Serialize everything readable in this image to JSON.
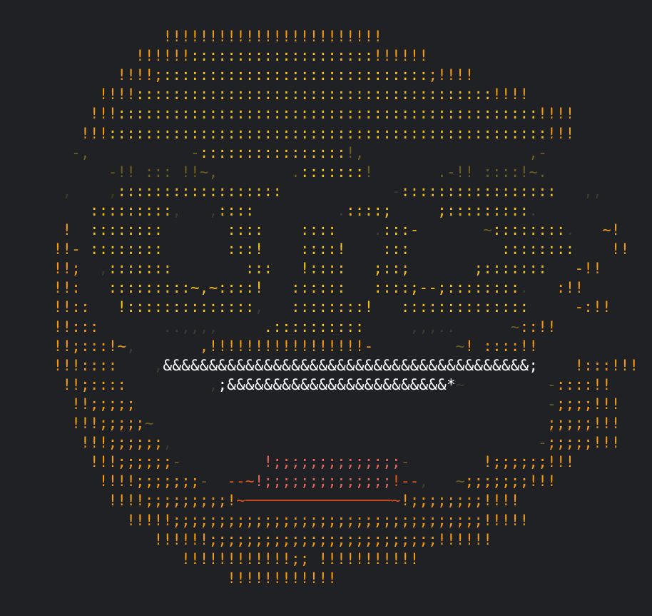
{
  "colors": {
    "background": "#1f2124",
    "rim": "#f29a16",
    "face": "#f3c01d",
    "shadow": "#6b6022",
    "faint": "#3a3b30",
    "teeth": "#ffffff",
    "lips": "#e0655c",
    "mouth_line": "#e0551f",
    "cheek": "#d8892a"
  },
  "rows": [
    [
      [
        "rim",
        "              !!!!!!!!!!!!!!!!!!!!!!!!"
      ]
    ],
    [
      [
        "rim",
        "           !!!!!!"
      ],
      [
        "face",
        "::::::::::::::::::::"
      ],
      [
        "rim",
        "!!!!!!"
      ]
    ],
    [
      [
        "rim",
        "         !!!!;"
      ],
      [
        "face",
        ":::::::::::::::::::::::::::::"
      ],
      [
        "rim",
        ";!!!!"
      ]
    ],
    [
      [
        "rim",
        "       !!!!"
      ],
      [
        "face",
        ":::::::::::::::::::::::::::::::::::::::"
      ],
      [
        "rim",
        "!!!!"
      ]
    ],
    [
      [
        "rim",
        "      !!!"
      ],
      [
        "face",
        "::::::::::::::::::::::::::::::::::::::::::::::"
      ],
      [
        "rim",
        "!!!!"
      ]
    ],
    [
      [
        "rim",
        "     !!!"
      ],
      [
        "face",
        "::::::::::::::::::::::::::::::::::::::::::::::::"
      ],
      [
        "rim",
        "!!!"
      ]
    ],
    [
      [
        "shadow",
        "    -,           -"
      ],
      [
        "face",
        "::::::::::::::::"
      ],
      [
        "shadow",
        "!,                  ,-"
      ]
    ],
    [
      [
        "shadow",
        "        -!! ::: !!~,        ."
      ],
      [
        "face",
        ":::::::"
      ],
      [
        "shadow",
        "!       .-!! ::::!~."
      ]
    ],
    [
      [
        "faint",
        "   ,    ,"
      ],
      [
        "face",
        "::::::::::::::::::"
      ],
      [
        "faint",
        "            -"
      ],
      [
        "face",
        ":::::::::::::::::"
      ],
      [
        "faint",
        "   ,,"
      ]
    ],
    [
      [
        "face",
        "      :::::::::"
      ],
      [
        "faint",
        ",   ,"
      ],
      [
        "face",
        "::::"
      ],
      [
        "faint",
        "         ."
      ],
      [
        "face",
        "::::;"
      ],
      [
        "faint",
        "     "
      ],
      [
        "face",
        ";:::::::::"
      ],
      [
        "faint",
        "."
      ]
    ],
    [
      [
        "rim",
        "   !"
      ],
      [
        "face",
        "  ::::::::"
      ],
      [
        "faint",
        "       "
      ],
      [
        "face",
        "::::    ::::    "
      ],
      [
        "faint",
        "."
      ],
      [
        "face",
        ":::-"
      ],
      [
        "faint",
        "       "
      ],
      [
        "shadow",
        "~"
      ],
      [
        "face",
        "::::::::"
      ],
      [
        "faint",
        "."
      ],
      [
        "rim",
        "   ~!"
      ]
    ],
    [
      [
        "rim",
        "  !!-"
      ],
      [
        "face",
        " ::::::::"
      ],
      [
        "faint",
        "       "
      ],
      [
        "face",
        ":::!    ::::!    :::"
      ],
      [
        "faint",
        "          "
      ],
      [
        "face",
        "::::::::"
      ],
      [
        "rim",
        "    !!"
      ]
    ],
    [
      [
        "rim",
        "  !!;"
      ],
      [
        "faint",
        "  ,"
      ],
      [
        "face",
        ":::::::"
      ],
      [
        "faint",
        "        "
      ],
      [
        "face",
        ":::   !::::   ;::;"
      ],
      [
        "faint",
        "       "
      ],
      [
        "face",
        ";:::::::"
      ],
      [
        "rim",
        "   -!!"
      ]
    ],
    [
      [
        "rim",
        "  !!:"
      ],
      [
        "faint",
        "  "
      ],
      [
        "face",
        " :::::::::~,~::::!   ::::::   ::::;--;::::::::"
      ],
      [
        "faint",
        "."
      ],
      [
        "rim",
        "   :!!"
      ]
    ],
    [
      [
        "rim",
        "  !!::"
      ],
      [
        "face",
        "   !::::::::::::::"
      ],
      [
        "faint",
        ","
      ],
      [
        "face",
        "   ::::::::!   ::::::::::::::"
      ],
      [
        "faint",
        "  "
      ],
      [
        "rim",
        "   -:!!"
      ]
    ],
    [
      [
        "rim",
        "  !!:::"
      ],
      [
        "faint",
        "       ..,,,,     "
      ],
      [
        "face",
        ".::::::::::"
      ],
      [
        "faint",
        "     ,,,.."
      ],
      [
        "faint",
        "      "
      ],
      [
        "shadow",
        "~"
      ],
      [
        "rim",
        "::!!"
      ]
    ],
    [
      [
        "rim",
        "  !!;:::!~"
      ],
      [
        "faint",
        ",       "
      ],
      [
        "rim",
        ",!!!!!!!!!!!!!!!!!-"
      ],
      [
        "faint",
        "         "
      ],
      [
        "shadow",
        "~"
      ],
      [
        "rim",
        "! ::::!!"
      ]
    ],
    [
      [
        "rim",
        "  !!!::::"
      ],
      [
        "faint",
        "    ,"
      ],
      [
        "teeth",
        "&&&&&&&&&&&&&&&&&&&&&&&&&&&&&&&&&&&&&&&&;"
      ],
      [
        "faint",
        "    "
      ],
      [
        "rim",
        "!:::!!!"
      ]
    ],
    [
      [
        "rim",
        "   !!;::::"
      ],
      [
        "faint",
        "         ,"
      ],
      [
        "teeth",
        ";&&&&&&&&&&&&&&&&&&&&&&&&*"
      ],
      [
        "faint",
        "~         "
      ],
      [
        "shadow",
        "-"
      ],
      [
        "rim",
        "::::!!"
      ]
    ],
    [
      [
        "rim",
        "    !!;;;;;"
      ],
      [
        "faint",
        "                                             "
      ],
      [
        "shadow",
        "-"
      ],
      [
        "rim",
        ";;;;!!!"
      ]
    ],
    [
      [
        "rim",
        "    !!!;;;;;"
      ],
      [
        "shadow",
        "~"
      ],
      [
        "faint",
        "                                           "
      ],
      [
        "rim",
        ";;;;;!!!"
      ]
    ],
    [
      [
        "rim",
        "     !!!;;;;;;"
      ],
      [
        "faint",
        ",                                        "
      ],
      [
        "shadow",
        "-"
      ],
      [
        "rim",
        ";;;;;!!!"
      ]
    ],
    [
      [
        "rim",
        "      !!!;;;;;;"
      ],
      [
        "shadow",
        "-"
      ],
      [
        "faint",
        "         "
      ],
      [
        "lips",
        "!;;;;;;;;;;;;;;"
      ],
      [
        "shadow",
        "-"
      ],
      [
        "faint",
        "        "
      ],
      [
        "rim",
        "!;;;;;;!!!"
      ]
    ],
    [
      [
        "rim",
        "       !!!!;;;;;;;"
      ],
      [
        "shadow",
        "-"
      ],
      [
        "faint",
        "  "
      ],
      [
        "mouth_line",
        "--~"
      ],
      [
        "lips",
        "!;;;;;;;;;;;;;;"
      ],
      [
        "mouth_line",
        "!--"
      ],
      [
        "faint",
        ",   "
      ],
      [
        "shadow",
        "~"
      ],
      [
        "rim",
        ";;;;;;;!!!"
      ]
    ],
    [
      [
        "rim",
        "        !!!!;;;;;;;;;!"
      ],
      [
        "mouth_line",
        "~"
      ],
      [
        "mouth_line",
        "────────────────"
      ],
      [
        "mouth_line",
        "~"
      ],
      [
        "rim",
        "!;;;;;;;;!!!!"
      ]
    ],
    [
      [
        "rim",
        "          !!!!!;;;;;;;;;;;;;;;;;;;;;;;;;;;;;;;;;;!!!!!"
      ]
    ],
    [
      [
        "rim",
        "             !!!!!!;;;;;;;;;;;;;;;;;;;;;;;;;!!!!!!"
      ]
    ],
    [
      [
        "rim",
        "                !!!!!!!!!!!!;; !!!!!!!!!!!"
      ]
    ],
    [
      [
        "rim",
        "                     !!!!!!!!!!!!"
      ]
    ]
  ]
}
